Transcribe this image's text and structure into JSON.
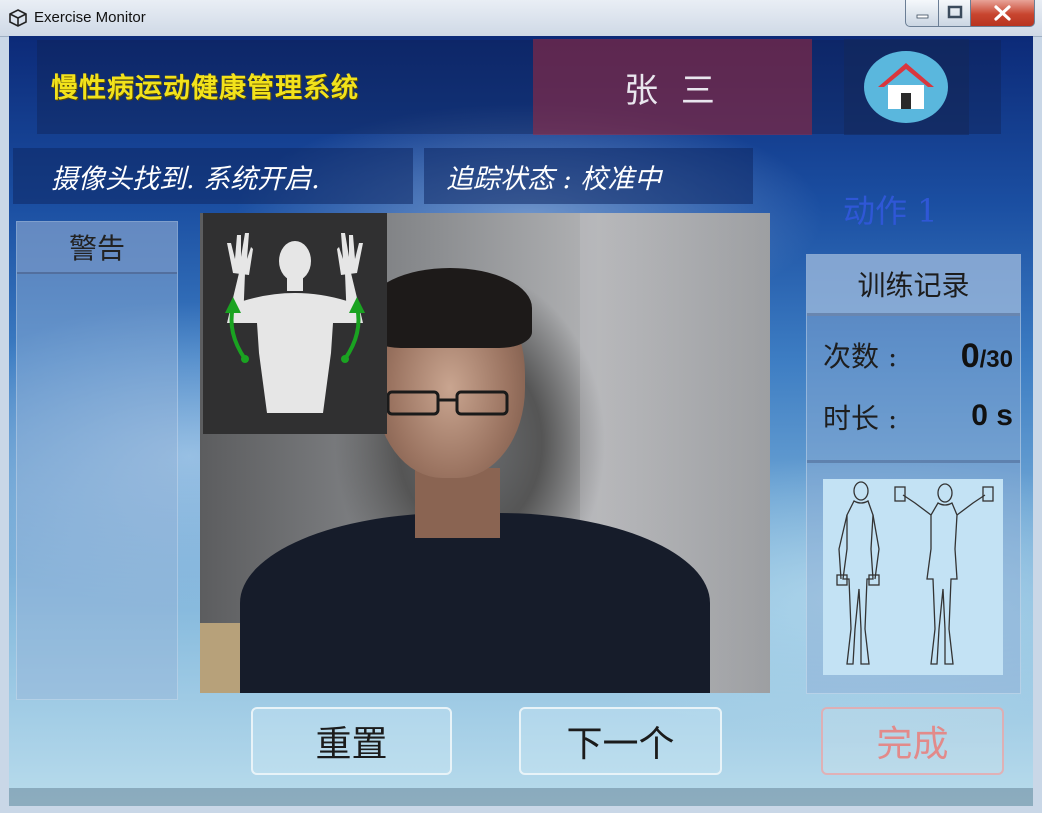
{
  "window": {
    "title": "Exercise Monitor"
  },
  "header": {
    "system_title": "慢性病运动健康管理系统",
    "user_name": "张 三",
    "home_icon": "home-icon"
  },
  "status": {
    "camera": "摄像头找到.  系统开启.",
    "tracking": "追踪状态 :   校准中"
  },
  "action": {
    "title": "动作 1"
  },
  "warning": {
    "title": "警告"
  },
  "record": {
    "title": "训练记录",
    "count_label": "次数 :",
    "count_value": "0",
    "count_total": "/30",
    "time_label": "时长 :",
    "time_value": "0 s"
  },
  "buttons": {
    "reset": "重置",
    "next": "下一个",
    "done": "完成"
  },
  "colors": {
    "title_yellow": "#f2e21b",
    "user_box": "#a0283c",
    "home_circle": "#5ab7dd",
    "action_blue": "#2f57d6",
    "done_text": "#e28a8a"
  }
}
